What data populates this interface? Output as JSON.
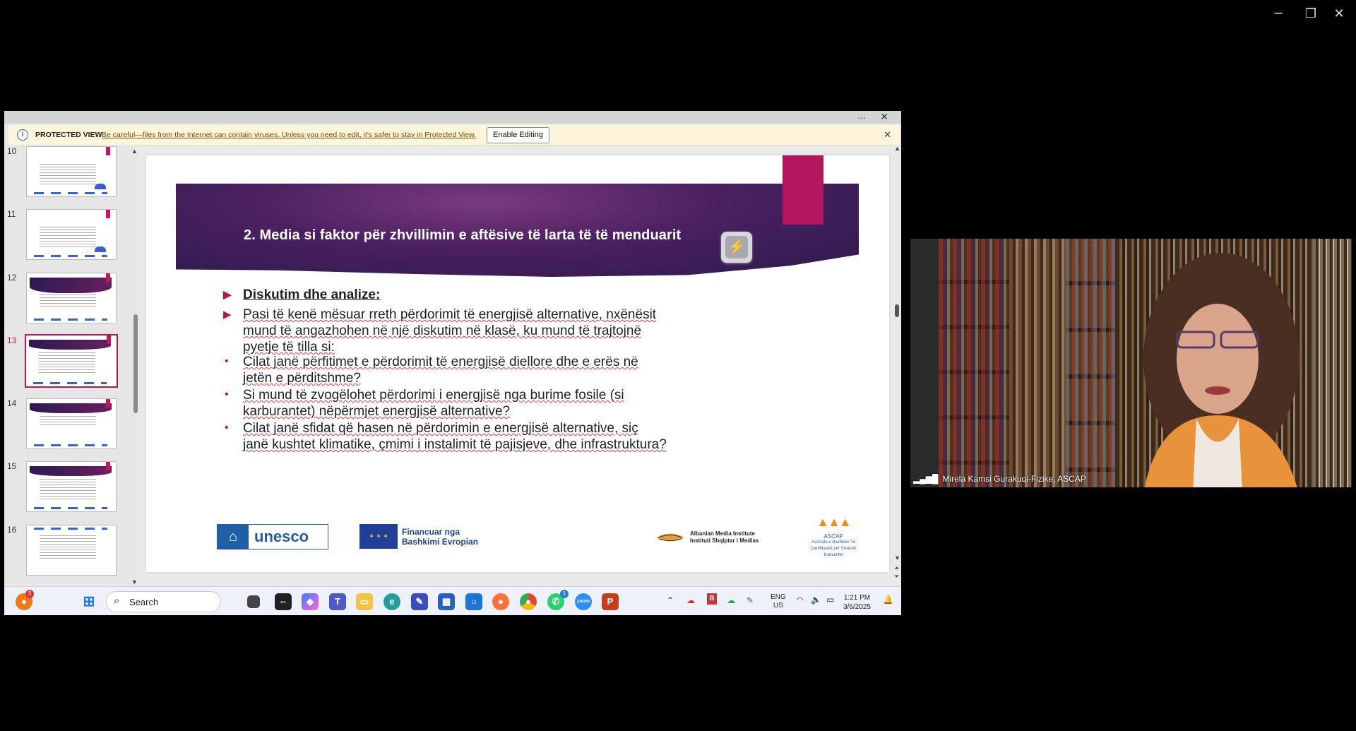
{
  "window": {
    "minimize_icon": "minimize-icon",
    "restore_icon": "restore-icon",
    "close_icon": "close-icon"
  },
  "shared_screen": {
    "top_dots": "...",
    "protected_view": {
      "title": "PROTECTED VIEW",
      "message": "Be careful—files from the Internet can contain viruses. Unless you need to edit, it's safer to stay in Protected View.",
      "button": "Enable Editing"
    },
    "thumbnails": [
      {
        "num": "10"
      },
      {
        "num": "11"
      },
      {
        "num": "12"
      },
      {
        "num": "13"
      },
      {
        "num": "14"
      },
      {
        "num": "15"
      },
      {
        "num": "16"
      }
    ],
    "active_slide": "13",
    "slide": {
      "title": "2. Media si faktor për zhvillimin e aftësive të larta të të menduarit",
      "heading": "Diskutim dhe analize:",
      "intro": "Pasi të kenë mësuar rreth përdorimit të energjisë alternative, nxënësit mund të angazhohen në një diskutim në klasë, ku mund të trajtojnë pyetje të tilla si:",
      "questions": [
        "Cilat janë përfitimet e përdorimit të energjisë diellore dhe e erës në jetën e përditshme?",
        "Si mund të zvogëlohet përdorimi i energjisë nga burime fosile (si karburantet) nëpërmjet energjisë alternative?",
        "Cilat janë sfidat që hasen në përdorimin e energjisë alternative, siç janë kushtet klimatike, çmimi i instalimit të pajisjeve, dhe infrastruktura?"
      ],
      "logos": {
        "unesco": "unesco",
        "eu_line1": "Financuar nga",
        "eu_line2": "Bashkimi Evropian",
        "ami_line1": "Albanian Media Institute",
        "ami_line2": "Instituti Shqiptar i Medias",
        "ascap": "ASCAP",
        "ascap_sub": "Asociata e Bashkisë Të Certifikuarë për Sistemit Komunitet"
      }
    },
    "taskbar": {
      "search_label": "Search",
      "lang": "ENG",
      "region": "US",
      "time": "1:21 PM",
      "date": "3/6/2025",
      "badge_left": "3",
      "badge_whatsapp": "1"
    }
  },
  "webcam": {
    "participant_name": "Mirela Kamsi Gurakuqi-Fizike, ASCAP"
  },
  "colors": {
    "accent_pink": "#b5175f",
    "banner_purple": "#4a2060"
  }
}
